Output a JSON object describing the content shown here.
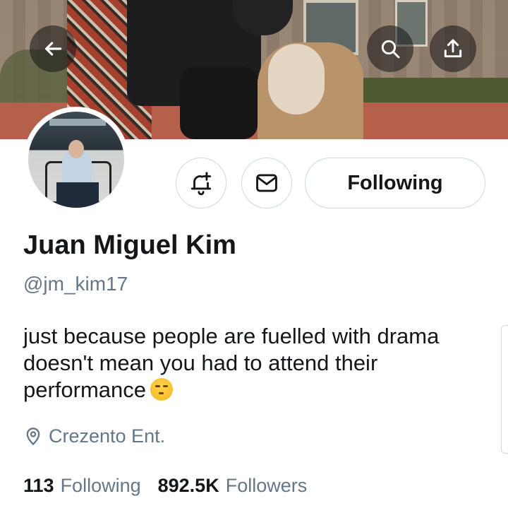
{
  "header": {
    "back_icon": "arrow-left-icon",
    "search_icon": "search-icon",
    "share_icon": "share-upload-icon"
  },
  "actions": {
    "notify_icon": "bell-plus-icon",
    "message_icon": "mail-icon",
    "following_label": "Following"
  },
  "profile": {
    "name": "Juan Miguel Kim",
    "handle": "@jm_kim17",
    "bio_text": "just because people are fuelled with drama doesn't mean you had to attend their performance",
    "bio_emoji": "smirking-face-emoji",
    "location": "Crezento Ent.",
    "location_icon": "map-pin-icon"
  },
  "stats": {
    "following_count": "113",
    "following_label": "Following",
    "followers_count": "892.5K",
    "followers_label": "Followers"
  },
  "colors": {
    "text_primary": "#14171a",
    "text_secondary": "#657786",
    "border": "#cfd9de"
  }
}
